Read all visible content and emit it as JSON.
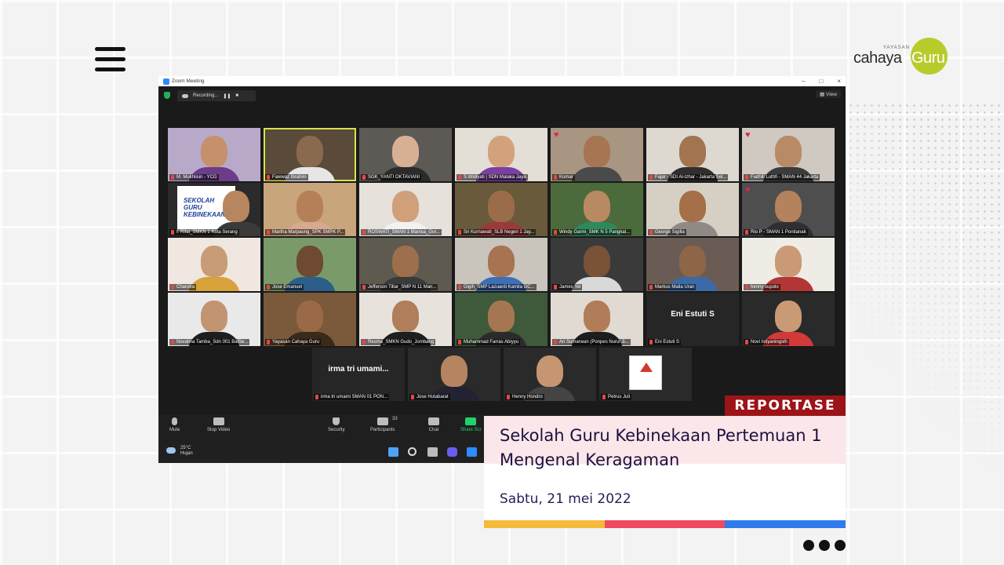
{
  "header": {
    "menu_icon": "hamburger-icon",
    "logo": {
      "small_text": "YAYASAN",
      "text_left": "cahaya",
      "text_right": "Guru"
    }
  },
  "zoom": {
    "window_title": "Zoom Meeting",
    "recording_label": "Recording...",
    "view_label": "View",
    "participants": [
      {
        "name": "M. Mukhlisin - YCG",
        "bg": "#b9a9c9",
        "skin": "#c6906a",
        "shirt": "#6b3c8a"
      },
      {
        "name": "Fawwaz Ibrahim",
        "bg": "#5a4a3a",
        "skin": "#8a6a4e",
        "shirt": "#e6e6e6",
        "active": true
      },
      {
        "name": "SGK_YANTI OKTAVIANI",
        "bg": "#5d5a56",
        "skin": "#d8b096",
        "shirt": "#2b2b2b"
      },
      {
        "name": "S.Widiyati | SDN Malaka Jaya",
        "bg": "#e3ded6",
        "skin": "#d2a27d",
        "shirt": "#7a3fa0"
      },
      {
        "name": "Komar",
        "bg": "#a89682",
        "skin": "#a67652",
        "shirt": "#4a4a4a",
        "heart": true
      },
      {
        "name": "Fajar - SDI Al-Izhar - Jakarta Sel...",
        "bg": "#ddd8d0",
        "skin": "#a37450",
        "shirt": "#2f2f2f"
      },
      {
        "name": "Fadhlil Luthfi - SMAN 44 Jakarta",
        "bg": "#cfc9c1",
        "skin": "#b88a66",
        "shirt": "#3b3b3b",
        "heart": true
      },
      {
        "name": "I. Rifai_SMKN 1 Kota Serang",
        "bg": "#2b2b2b",
        "skin": "#b8865e",
        "shirt": "#3a3a3a",
        "banner": "SEKOLAH GURU KEBINEKAAN"
      },
      {
        "name": "Martha Marpaung_SPK SMPK P...",
        "bg": "#c9a57c",
        "skin": "#b57f57",
        "shirt": "#d8a88f"
      },
      {
        "name": "ROSWATI_SMAN 1 Manisa_Gor...",
        "bg": "#e6e1da",
        "skin": "#cfa07a",
        "shirt": "#f2f2f2"
      },
      {
        "name": "Sri Kurnawati_SLB Negeri 1 Jay...",
        "bg": "#6a5a3c",
        "skin": "#9b6c49",
        "shirt": "#9a3a3a"
      },
      {
        "name": "Windy Garini_SMK N 5 Pangkal...",
        "bg": "#4c6b3c",
        "skin": "#b78a62",
        "shirt": "#2e8a5a"
      },
      {
        "name": "George Sigilla",
        "bg": "#d6d0c4",
        "skin": "#a56f4a",
        "shirt": "#8f8a84"
      },
      {
        "name": "Rio P - SMAN 1 Pontianak",
        "bg": "#4e4e4e",
        "skin": "#b4825c",
        "shirt": "#2f2f2f",
        "heart": true
      },
      {
        "name": "Chandra",
        "bg": "#efe7e0",
        "skin": "#c99c78",
        "shirt": "#d7a23a"
      },
      {
        "name": "Jose Emanuel",
        "bg": "#7a9a6a",
        "skin": "#6e4a32",
        "shirt": "#2c5e8a"
      },
      {
        "name": "Jefferson Tillar_SMP N 11 Man...",
        "bg": "#5e5a50",
        "skin": "#9d6f4d",
        "shirt": "#3a3a3a"
      },
      {
        "name": "Gigih_SMP Lazuardi Kamila GC...",
        "bg": "#c9c4bc",
        "skin": "#a87350",
        "shirt": "#3c6fb8"
      },
      {
        "name": "James Yel",
        "bg": "#3a3a3a",
        "skin": "#7a5238",
        "shirt": "#d9d9d9"
      },
      {
        "name": "Markus Malia Uran",
        "bg": "#6a5c55",
        "skin": "#8e6547",
        "shirt": "#3b6aa8"
      },
      {
        "name": "henny supolo",
        "bg": "#efece6",
        "skin": "#c99a75",
        "shirt": "#b23636"
      },
      {
        "name": "Novalina Tamba_Sdn 001 BalSe...",
        "bg": "#e9e9e9",
        "skin": "#c29472",
        "shirt": "#1e1e1e"
      },
      {
        "name": "Yayasan Cahaya Guru",
        "bg": "#7a5a3a",
        "skin": "#9a6a48",
        "shirt": "#3a2a1a"
      },
      {
        "name": "Resma_SMKN Gudo_Jombang",
        "bg": "#e7e2dc",
        "skin": "#b07e5a",
        "shirt": "#1e1e1e"
      },
      {
        "name": "Muhammad Farras Abiyyu",
        "bg": "#3e5a3a",
        "skin": "#a67652",
        "shirt": "#2b2b2b"
      },
      {
        "name": "Ari Sumarwan (Ponpes Nurul Ji...",
        "bg": "#e0dad2",
        "skin": "#b07d58",
        "shirt": "#1d1d1d"
      },
      {
        "name": "Eni Estuti S",
        "display_name": "Eni Estuti S"
      },
      {
        "name": "Novi Istiyaningsih",
        "bg": "#2a2a2a",
        "skin": "#c99a75",
        "shirt": "#d23a3a"
      },
      {
        "name": "irma tri umami SMAN 01 PON...",
        "display_name": "irma tri umami..."
      },
      {
        "name": "Jose Hutabarat",
        "bg": "#2a2a2a",
        "skin": "#b58460",
        "shirt": "#222233"
      },
      {
        "name": "Henny Hondro",
        "bg": "#2a2a2a",
        "skin": "#c69572",
        "shirt": "#444444"
      },
      {
        "name": "Petrus Juli",
        "bg": "#2a2a2a",
        "skin": "#ffffff",
        "shirt": "#ffffff",
        "logo": true
      }
    ],
    "toolbar": {
      "mute": "Mute",
      "stop_video": "Stop Video",
      "security": "Security",
      "participants": "Participants",
      "participants_count": "33",
      "chat": "Chat",
      "share_screen": "Share Scr"
    },
    "taskbar": {
      "temperature": "25°C",
      "weather": "Hujan"
    }
  },
  "caption": {
    "badge": "REPORTASE",
    "title": "Sekolah Guru Kebinekaan Pertemuan 1 Mengenal Keragaman",
    "date": "Sabtu, 21 mei 2022"
  },
  "colors": {
    "badge": "#9c1418",
    "bar1": "#f6b93b",
    "bar2": "#ef4a5d",
    "bar3": "#2f7ded",
    "logo_circle": "#b7cc2b",
    "active_speaker": "#d8e34b"
  }
}
